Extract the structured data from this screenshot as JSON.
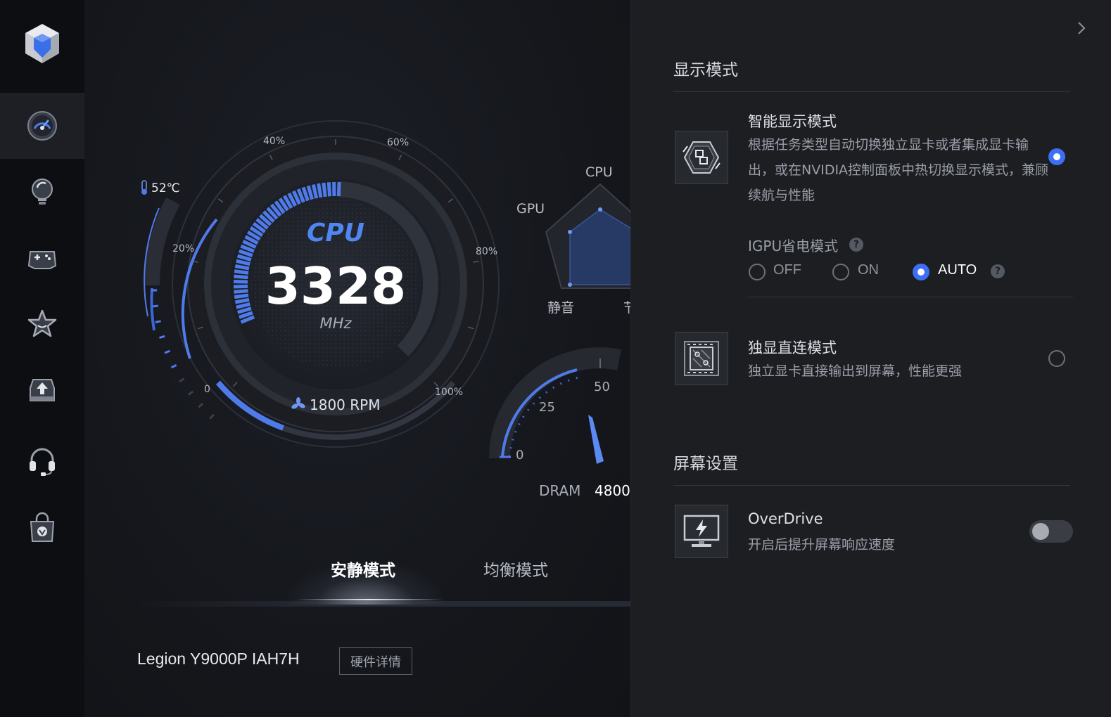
{
  "sidebar": {
    "items": [
      {
        "name": "logo-icon"
      },
      {
        "name": "dashboard-gauge-icon",
        "active": true
      },
      {
        "name": "lightbulb-icon"
      },
      {
        "name": "gamepad-icon"
      },
      {
        "name": "star-icon"
      },
      {
        "name": "upload-tray-icon"
      },
      {
        "name": "headset-icon"
      },
      {
        "name": "store-bag-icon"
      }
    ]
  },
  "gauge": {
    "title": "CPU",
    "value": "3328",
    "unit": "MHz",
    "temperature": "52℃",
    "fan": "1800 RPM",
    "ticks": [
      "0",
      "20%",
      "40%",
      "60%",
      "80%",
      "100%"
    ],
    "load_fraction": 0.38,
    "fan_fraction": 0.3
  },
  "radar": {
    "labels": {
      "cpu": "CPU",
      "gpu": "GPU",
      "quiet": "静音",
      "cut": "节"
    }
  },
  "memory": {
    "ticks": [
      "0",
      "25",
      "50"
    ],
    "label": "DRAM",
    "value": "4800"
  },
  "modes": {
    "quiet": "安静模式",
    "balanced": "均衡模式",
    "selected": "quiet"
  },
  "device": {
    "model": "Legion Y9000P IAH7H",
    "hardware_button": "硬件详情"
  },
  "panel": {
    "display_mode_title": "显示模式",
    "smart": {
      "title": "智能显示模式",
      "desc": "根据任务类型自动切换独立显卡或者集成显卡输出，或在NVIDIA控制面板中热切换显示模式，兼顾续航与性能",
      "selected": true
    },
    "igpu": {
      "title": "IGPU省电模式",
      "options": [
        "OFF",
        "ON",
        "AUTO"
      ],
      "selected": "AUTO",
      "help": "?"
    },
    "direct": {
      "title": "独显直连模式",
      "desc": "独立显卡直接输出到屏幕，性能更强",
      "selected": false
    },
    "screen_title": "屏幕设置",
    "overdrive": {
      "title": "OverDrive",
      "desc": "开启后提升屏幕响应速度",
      "enabled": false
    }
  },
  "colors": {
    "accent": "#3d6ef5",
    "gauge_blue": "#4f7bea",
    "panel_bg": "#1c1e22",
    "rail_bg": "#0d0e11"
  }
}
